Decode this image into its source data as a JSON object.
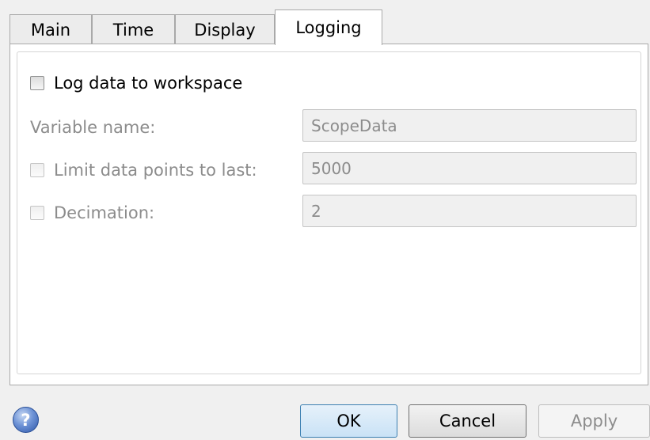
{
  "tabs": [
    {
      "label": "Main"
    },
    {
      "label": "Time"
    },
    {
      "label": "Display"
    },
    {
      "label": "Logging",
      "active": true
    }
  ],
  "logging": {
    "log_to_workspace": {
      "label": "Log data to workspace",
      "checked": false
    },
    "variable_name": {
      "label": "Variable name:",
      "value": "ScopeData"
    },
    "limit_points": {
      "label": "Limit data points to last:",
      "checked": false,
      "value": "5000"
    },
    "decimation": {
      "label": "Decimation:",
      "checked": false,
      "value": "2"
    }
  },
  "footer": {
    "help_icon": "help-icon",
    "help_glyph": "?",
    "ok_label": "OK",
    "cancel_label": "Cancel",
    "apply_label": "Apply"
  },
  "colors": {
    "accent_border": "#3c7fb1",
    "disabled_text": "#8c8c8c"
  }
}
